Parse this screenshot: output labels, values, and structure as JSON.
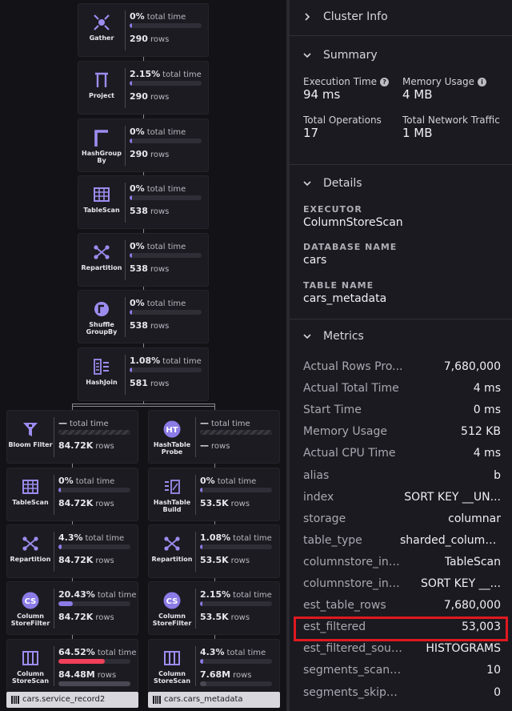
{
  "plan": {
    "center_nodes": [
      {
        "label": "Gather",
        "pct": "0%",
        "pct_unit": "total time",
        "rows": "290",
        "rows_unit": "rows",
        "fill": 0.0,
        "icon": "gather-icon"
      },
      {
        "label": "Project",
        "pct": "2.15%",
        "pct_unit": "total time",
        "rows": "290",
        "rows_unit": "rows",
        "fill": 0.0215,
        "icon": "project-icon"
      },
      {
        "label": "HashGroup By",
        "pct": "0%",
        "pct_unit": "total time",
        "rows": "290",
        "rows_unit": "rows",
        "fill": 0.0,
        "icon": "hashgroupby-icon"
      },
      {
        "label": "TableScan",
        "pct": "0%",
        "pct_unit": "total time",
        "rows": "538",
        "rows_unit": "rows",
        "fill": 0.0,
        "icon": "table-icon"
      },
      {
        "label": "Repartition",
        "pct": "0%",
        "pct_unit": "total time",
        "rows": "538",
        "rows_unit": "rows",
        "fill": 0.0,
        "icon": "repartition-icon"
      },
      {
        "label": "Shuffle GroupBy",
        "pct": "0%",
        "pct_unit": "total time",
        "rows": "538",
        "rows_unit": "rows",
        "fill": 0.0,
        "icon": "shuffle-groupby-icon"
      },
      {
        "label": "HashJoin",
        "pct": "1.08%",
        "pct_unit": "total time",
        "rows": "581",
        "rows_unit": "rows",
        "fill": 0.0108,
        "icon": "hashjoin-icon"
      }
    ],
    "left_nodes": [
      {
        "label": "Bloom Filter",
        "pct": "—",
        "pct_unit": "total time",
        "rows": "84.72K",
        "rows_unit": "rows",
        "fill": 0,
        "hatch": true,
        "icon": "bloom-filter-icon"
      },
      {
        "label": "TableScan",
        "pct": "0%",
        "pct_unit": "total time",
        "rows": "84.72K",
        "rows_unit": "rows",
        "fill": 0.0,
        "icon": "table-icon"
      },
      {
        "label": "Repartition",
        "pct": "4.3%",
        "pct_unit": "total time",
        "rows": "84.72K",
        "rows_unit": "rows",
        "fill": 0.043,
        "icon": "repartition-icon"
      },
      {
        "label": "Column StoreFilter",
        "pct": "20.43%",
        "pct_unit": "total time",
        "rows": "84.72K",
        "rows_unit": "rows",
        "fill": 0.2043,
        "icon": "cs-icon"
      },
      {
        "label": "Column StoreScan",
        "pct": "64.52%",
        "pct_unit": "total time",
        "rows": "84.48M",
        "rows_unit": "rows",
        "fill": 0.6452,
        "hot": true,
        "rowfill": 1.0,
        "icon": "columnstore-scan-icon"
      }
    ],
    "right_nodes": [
      {
        "label": "HashTable Probe",
        "pct": "—",
        "pct_unit": "total time",
        "rows": "—",
        "rows_unit": "rows",
        "fill": 0,
        "hatch": true,
        "icon": "ht-icon"
      },
      {
        "label": "HashTable Build",
        "pct": "0%",
        "pct_unit": "total time",
        "rows": "53.5K",
        "rows_unit": "rows",
        "fill": 0.0,
        "icon": "hashtable-build-icon"
      },
      {
        "label": "Repartition",
        "pct": "1.08%",
        "pct_unit": "total time",
        "rows": "53.5K",
        "rows_unit": "rows",
        "fill": 0.0108,
        "icon": "repartition-icon"
      },
      {
        "label": "Column StoreFilter",
        "pct": "2.15%",
        "pct_unit": "total time",
        "rows": "53.5K",
        "rows_unit": "rows",
        "fill": 0.0215,
        "icon": "cs-icon"
      },
      {
        "label": "Column StoreScan",
        "pct": "4.3%",
        "pct_unit": "total time",
        "rows": "7.68M",
        "rows_unit": "rows",
        "fill": 0.043,
        "rowfill": 0.09,
        "icon": "columnstore-scan-icon"
      }
    ],
    "table_left": "cars.service_record2",
    "table_right": "cars.cars_metadata"
  },
  "panel": {
    "cluster_info": "Cluster Info",
    "summary": {
      "title": "Summary",
      "exec_label": "Execution Time",
      "exec_value": "94 ms",
      "mem_label": "Memory Usage",
      "mem_value": "4 MB",
      "ops_label": "Total Operations",
      "ops_value": "17",
      "net_label": "Total Network Traffic",
      "net_value": "1 MB"
    },
    "details": {
      "title": "Details",
      "executor_label": "EXECUTOR",
      "executor_value": "ColumnStoreScan",
      "db_label": "DATABASE NAME",
      "db_value": "cars",
      "table_label": "TABLE NAME",
      "table_value": "cars_metadata"
    },
    "metrics": {
      "title": "Metrics",
      "rows": [
        {
          "k": "Actual Rows Pro...",
          "v": "7,680,000"
        },
        {
          "k": "Actual Total Time",
          "v": "4 ms"
        },
        {
          "k": "Start Time",
          "v": "0 ms"
        },
        {
          "k": "Memory Usage",
          "v": "512 KB"
        },
        {
          "k": "Actual CPU Time",
          "v": "4 ms"
        },
        {
          "k": "alias",
          "v": "b"
        },
        {
          "k": "index",
          "v": "SORT KEY __UN..."
        },
        {
          "k": "storage",
          "v": "columnar"
        },
        {
          "k": "table_type",
          "v": "sharded_column..."
        },
        {
          "k": "columnstore_in_...",
          "v": "TableScan"
        },
        {
          "k": "columnstore_in_...",
          "v": "SORT KEY __..."
        },
        {
          "k": "est_table_rows",
          "v": "7,680,000"
        },
        {
          "k": "est_filtered",
          "v": "53,003"
        },
        {
          "k": "est_filtered_sour...",
          "v": "HISTOGRAMS"
        },
        {
          "k": "segments_scann...",
          "v": "10"
        },
        {
          "k": "segments_skipped",
          "v": "0"
        }
      ]
    },
    "accent": "#8b7be6",
    "highlight_color": "#e0181f"
  }
}
